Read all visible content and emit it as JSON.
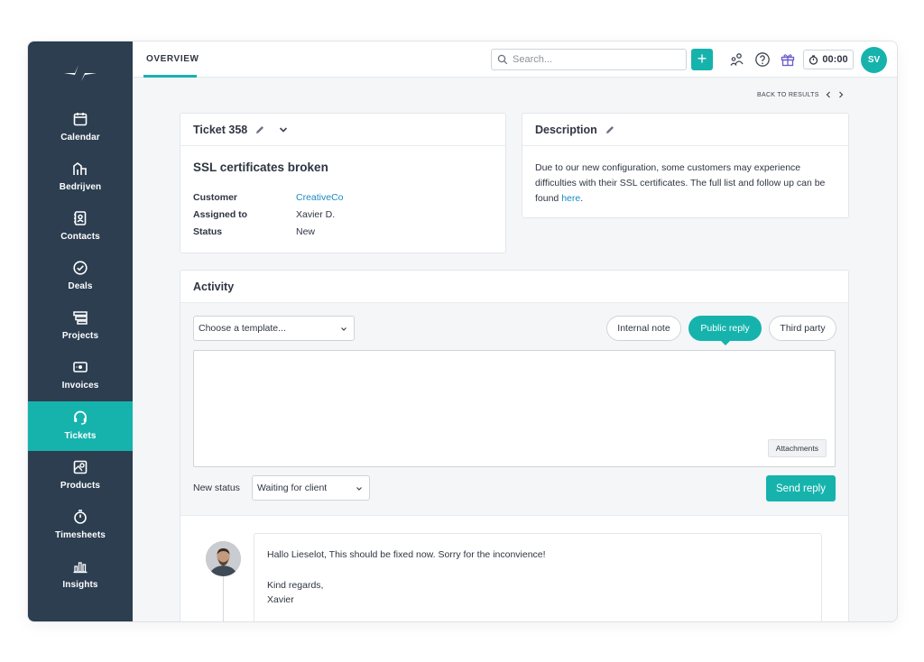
{
  "sidebar": {
    "items": [
      {
        "label": "Calendar",
        "icon": "calendar-icon"
      },
      {
        "label": "Bedrijven",
        "icon": "buildings-icon"
      },
      {
        "label": "Contacts",
        "icon": "contacts-book-icon"
      },
      {
        "label": "Deals",
        "icon": "check-circle-icon"
      },
      {
        "label": "Projects",
        "icon": "projects-stack-icon"
      },
      {
        "label": "Invoices",
        "icon": "invoice-icon"
      },
      {
        "label": "Tickets",
        "icon": "headset-icon",
        "active": true
      },
      {
        "label": "Products",
        "icon": "products-icon"
      },
      {
        "label": "Timesheets",
        "icon": "stopwatch-icon"
      },
      {
        "label": "Insights",
        "icon": "bar-chart-icon"
      }
    ]
  },
  "topbar": {
    "tab_overview": "OVERVIEW",
    "search_placeholder": "Search...",
    "add_label": "+",
    "timer": "00:00",
    "avatar_initials": "SV"
  },
  "nav": {
    "back_to_results": "BACK TO RESULTS"
  },
  "ticket": {
    "title": "Ticket 358",
    "subject": "SSL certificates broken",
    "fields": [
      {
        "label": "Customer",
        "value": "CreativeCo"
      },
      {
        "label": "Assigned to",
        "value": "Xavier D."
      },
      {
        "label": "Status",
        "value": "New"
      }
    ]
  },
  "description": {
    "title": "Description",
    "text": "Due to our new configuration, some customers may experience difficulties with their SSL certificates. The full list and follow up can be found ",
    "link_text": "here",
    "text_end": "."
  },
  "activity": {
    "title": "Activity",
    "template_placeholder": "Choose a template...",
    "reply_types": [
      "Internal note",
      "Public reply",
      "Third party"
    ],
    "attachments_label": "Attachments",
    "new_status_label": "New status",
    "new_status_value": "Waiting for client",
    "send_label": "Send reply",
    "message": {
      "line1": "Hallo Lieselot, This should be fixed now. Sorry for the inconvience!",
      "line2": "Kind regards,",
      "line3": "Xavier"
    }
  },
  "colors": {
    "accent": "#16b3ad",
    "sidebar": "#2c3e50",
    "link": "#1a8bbf"
  }
}
